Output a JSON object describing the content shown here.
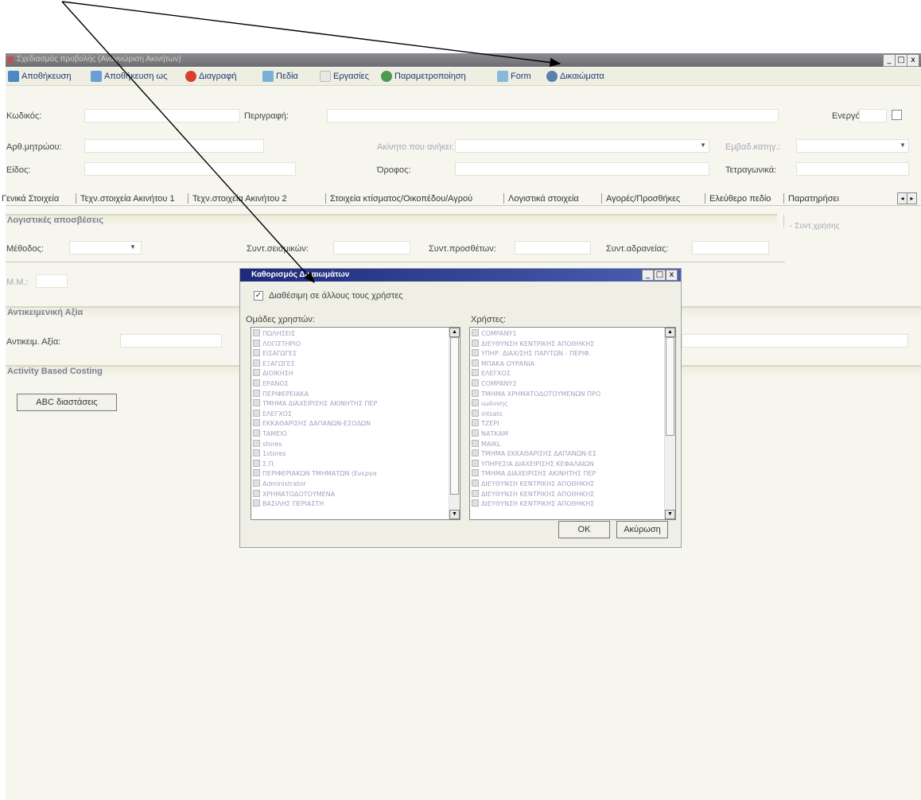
{
  "window": {
    "title": "Σχεδιασμός προβολής (Αναγνώριση Ακινήτων)",
    "controls": {
      "minimize": "_",
      "maximize": "□",
      "close": "x"
    }
  },
  "toolbar": {
    "save": "Αποθήκευση",
    "save_as": "Αποθήκευση ως",
    "delete": "Διαγραφή",
    "fields": "Πεδία",
    "tasks": "Εργασίες",
    "parameterize": "Παραμετροποίηση",
    "form": "Form",
    "rights": "Δικαιώματα"
  },
  "header": {
    "code_label": "Κωδικός:",
    "description_label": "Περιγραφή:",
    "active_label": "Ενεργό:",
    "registry_label": "Αρθ.μητρώου:",
    "property_owner_label": "Ακίνητο που ανήκει:",
    "area_label": "Εμβαδ.κατηγ.:",
    "type_label": "Είδος:",
    "floor_label": "Όροφος:",
    "sqm_label": "Τετραγωνικά:"
  },
  "tabs": [
    "Γενικά Στοιχεία",
    "Τεχν.στοιχεία Ακινήτου 1",
    "Τεχν.στοιχεία Ακινήτου 2",
    "Στοιχεία κτίσματος/Οικοπέδου/Αγρού",
    "Λογιστικά στοιχεία",
    "Αγορές/Προσθήκες",
    "Ελεύθερο πεδίο",
    "Παρατηρήσει"
  ],
  "tab_arrows": {
    "left": "◂",
    "right": "▸"
  },
  "sections": {
    "depreciation": {
      "title": "Λογιστικές αποσβέσεις",
      "method_label": "Μέθοδος:",
      "coef_label": "Συντ.σεισμικών:",
      "additions_label": "Συντ.προσθέτων:",
      "inaccuracy_label": "Συντ.αδρανείας:",
      "usage_label": "- Συντ.χρήσης",
      "mm_label": "Μ.Μ.:"
    },
    "objective": {
      "title": "Αντικειμενική Αξία",
      "value_label": "Αντικειμ. Αξία:"
    },
    "abc": {
      "title": "Activity Based Costing",
      "button": "ABC διαστάσεις"
    }
  },
  "dialog": {
    "title": "Καθορισμός Δικαιωμάτων",
    "share_label": "Διαθέσιμη σε άλλους τους χρήστες",
    "share_checked": true,
    "groups_label": "Ομάδες χρηστών:",
    "users_label": "Χρήστες:",
    "groups": [
      "ΠΩΛΗΣΕΙΣ",
      "ΛΟΓΙΣΤΗΡΙΟ",
      "ΕΙΣΑΓΩΓΕΣ",
      "ΕΞΑΓΩΓΕΣ",
      "ΔΙΟΙΚΗΣΗ",
      "ΕΡΑΝΟΣ",
      "ΠΕΡΙΦΕΡΕΙΑΚΑ",
      "ΤΜΗΜΑ ΔΙΑΧΕΙΡΙΣΗΣ ΑΚΙΝΗΤΗΣ ΠΕΡ",
      "ΕΛΕΓΧΟΣ",
      "ΕΚΚΑΘΑΡΙΣΗΣ ΔΑΠΑΝΩΝ-ΕΣΟΔΩΝ",
      "ΤΑΜΕΙΟ",
      "stores",
      "1stores",
      "Σ.Π.",
      "ΠΕΡΙΦΕΡΙΑΚΩΝ ΤΜΗΜΑΤΩΝ (Ενεργα",
      "Administrator",
      "ΧΡΗΜΑΤΟΔΟΤΟΥΜΕΝΑ",
      "ΒΑΣΙΛΗΣ ΠΕΡΙΑΣΤΗ"
    ],
    "users": [
      "COMPANY1",
      "ΔΙΕΥΘΥΝΣΗ ΚΕΝΤΡΙΚΗΣ ΑΠΟΘΗΚΗΣ",
      "ΥΠΗΡ. ΔΙΑΧ/ΣΗΣ ΠΑΡ/ΤΩΝ - ΠΕΡΙΦ.",
      "ΜΠΑΚΑ ΟΥΡΑΝΙΑ",
      "ΕΛΕΓΧΟΣ",
      "COMPANY2",
      "ΤΜΗΜΑ ΧΡΗΜΑΤΟΔΟΤΟΥΜΕΝΩΝ ΠΡΟ",
      "ιωάννης",
      "intsats",
      "ΤΖΕΡΙ",
      "ΝΑΤΚΑΜ",
      "ΜΑΙΚL",
      "ΤΜΗΜΑ ΕΚΚΑΘΑΡΙΣΗΣ ΔΑΠΑΝΩΝ-ΕΣ",
      "ΥΠΗΡΕΣΙΑ ΔΙΑΧΕΙΡΙΣΗΣ ΚΕΦΑΛΑΙΩΝ",
      "ΤΜΗΜΑ ΔΙΑΧΕΙΡΙΣΗΣ ΑΚΙΝΗΤΗΣ ΠΕΡ",
      "ΔΙΕΥΘΥΝΣΗ ΚΕΝΤΡΙΚΗΣ ΑΠΟΘΗΚΗΣ",
      "ΔΙΕΥΘΥΝΣΗ ΚΕΝΤΡΙΚΗΣ ΑΠΟΘΗΚΗΣ",
      "ΔΙΕΥΘΥΝΣΗ ΚΕΝΤΡΙΚΗΣ ΑΠΟΘΗΚΗΣ"
    ],
    "ok": "OK",
    "cancel": "Ακύρωση",
    "controls": {
      "minimize": "_",
      "maximize": "□",
      "close": "x"
    }
  },
  "colors": {
    "title_bar": "#76787c",
    "dialog_title": "#1e2a7a",
    "annotation_arrow": "#000000"
  }
}
